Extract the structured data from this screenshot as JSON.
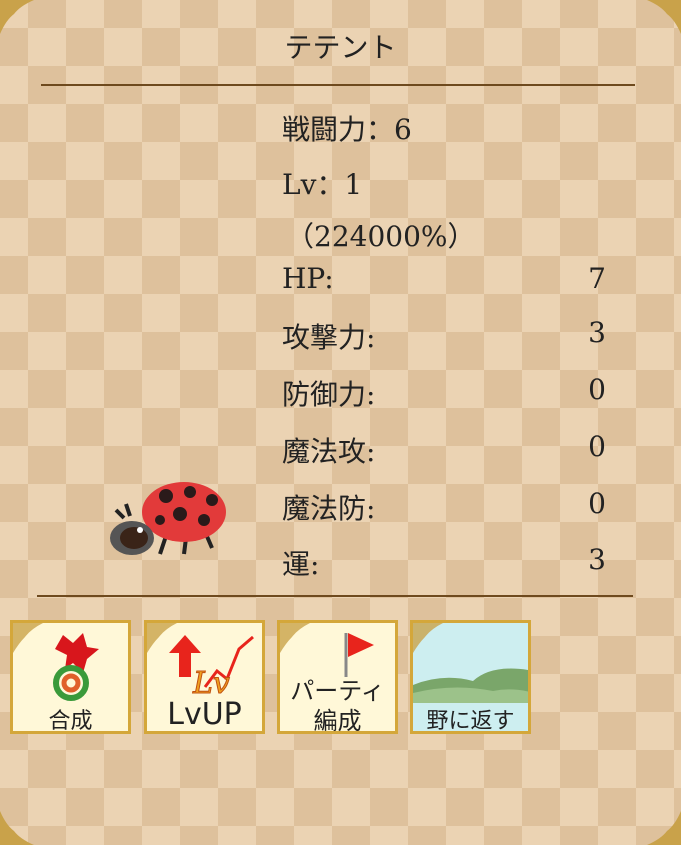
{
  "monster": {
    "name": "テテント",
    "icon": "ladybug-icon",
    "colors": {
      "body": "#e23a3a",
      "spots": "#2a1a1a",
      "head": "#3a3a3a"
    }
  },
  "stats": {
    "power_label": "戦闘力：6",
    "level_label": "Lv：1",
    "exp_label": "（224000%）",
    "rows": [
      {
        "label": "HP:",
        "value": "7"
      },
      {
        "label": "攻撃力:",
        "value": "3"
      },
      {
        "label": "防御力:",
        "value": "0"
      },
      {
        "label": "魔法攻:",
        "value": "0"
      },
      {
        "label": "魔法防:",
        "value": "0"
      },
      {
        "label": "運:",
        "value": "3"
      }
    ]
  },
  "actions": [
    {
      "label": "合成",
      "icon": "fusion-icon"
    },
    {
      "label": "LvUP",
      "icon": "level-up-icon"
    },
    {
      "label_line1": "パーティ",
      "label_line2": "編成",
      "icon": "flag-icon"
    },
    {
      "label": "野に返す",
      "icon": "field-icon"
    }
  ]
}
